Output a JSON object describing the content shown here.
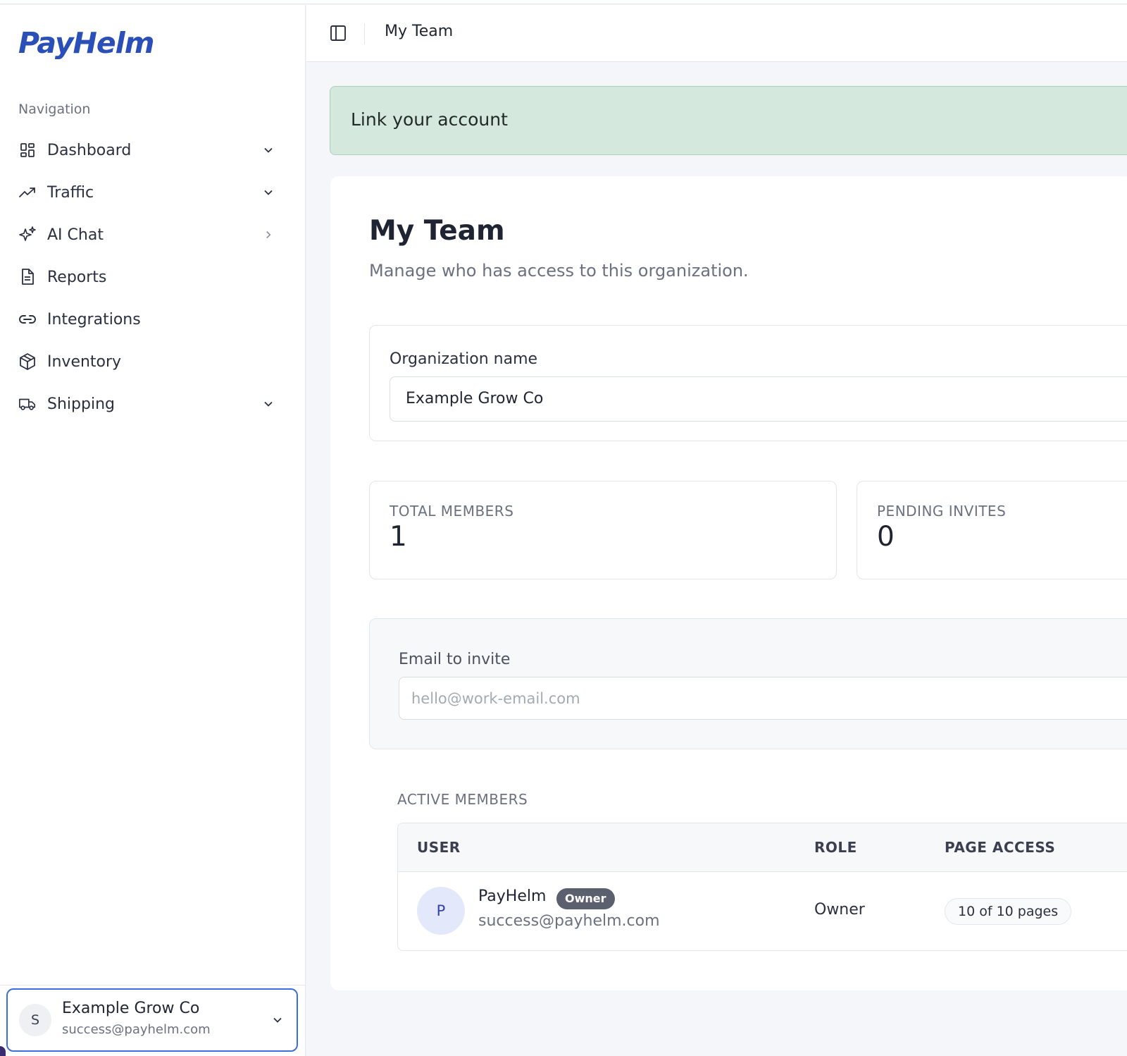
{
  "brand": {
    "name": "PayHelm"
  },
  "sidebar": {
    "heading": "Navigation",
    "items": [
      {
        "label": "Dashboard",
        "icon": "dashboard-grid-icon",
        "chevron": "down"
      },
      {
        "label": "Traffic",
        "icon": "trending-up-icon",
        "chevron": "down"
      },
      {
        "label": "AI Chat",
        "icon": "sparkles-icon",
        "chevron": "right"
      },
      {
        "label": "Reports",
        "icon": "document-icon",
        "chevron": ""
      },
      {
        "label": "Integrations",
        "icon": "link-icon",
        "chevron": ""
      },
      {
        "label": "Inventory",
        "icon": "package-icon",
        "chevron": ""
      },
      {
        "label": "Shipping",
        "icon": "truck-icon",
        "chevron": "down"
      }
    ],
    "account": {
      "initial": "S",
      "name": "Example Grow Co",
      "email": "success@payhelm.com"
    }
  },
  "header": {
    "title": "My Team"
  },
  "banner": {
    "text": "Link your account",
    "color": "#d5e8de"
  },
  "main": {
    "title": "My Team",
    "subtitle": "Manage who has access to this organization.",
    "org": {
      "label": "Organization name",
      "value": "Example Grow Co"
    },
    "stats": [
      {
        "label": "TOTAL MEMBERS",
        "value": "1"
      },
      {
        "label": "PENDING INVITES",
        "value": "0"
      }
    ],
    "invite": {
      "label": "Email to invite",
      "placeholder": "hello@work-email.com"
    },
    "members": {
      "section_label": "ACTIVE MEMBERS",
      "columns": [
        "USER",
        "ROLE",
        "PAGE ACCESS"
      ],
      "rows": [
        {
          "initial": "P",
          "name": "PayHelm",
          "badge": "Owner",
          "email": "success@payhelm.com",
          "role": "Owner",
          "page_access": "10 of 10 pages"
        }
      ]
    }
  },
  "colors": {
    "brand": "#2a4fb8",
    "accent_border": "#3b6fe0",
    "banner_border": "#a9d1ba"
  }
}
